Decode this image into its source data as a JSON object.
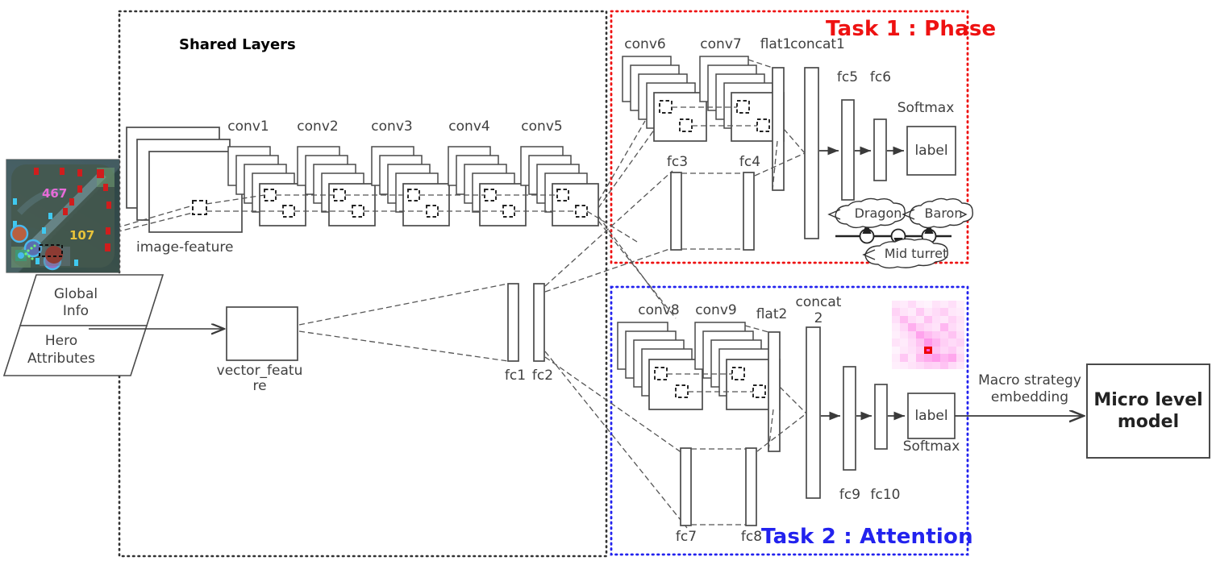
{
  "diagram": {
    "title_shared": "Shared Layers",
    "task1_label": "Task 1 : Phase",
    "task2_label": "Task 2 : Attention",
    "task1_color": "#ee1111",
    "task2_color": "#2222ee",
    "shared_border_color": "#333333"
  },
  "inputs": {
    "minimap_name": "game-minimap",
    "minimap_numbers": [
      "467",
      "107"
    ],
    "global_info": "Global\nInfo",
    "global_info_line1": "Global",
    "global_info_line2": "Info",
    "hero_attr_line1": "Hero",
    "hero_attr_line2": "Attributes",
    "image_feature": "image-feature",
    "vector_feature_line1": "vector_featu",
    "vector_feature_line2": "re"
  },
  "shared": {
    "conv_labels": [
      "conv1",
      "conv2",
      "conv3",
      "conv4",
      "conv5"
    ],
    "fc_labels": [
      "fc1",
      "fc2"
    ]
  },
  "task1": {
    "conv_labels": [
      "conv6",
      "conv7"
    ],
    "flat_label": "flat1",
    "concat_label": "concat1",
    "fc_upper": [
      "fc3",
      "fc4"
    ],
    "fc_head": [
      "fc5",
      "fc6"
    ],
    "softmax_label": "Softmax",
    "label_box": "label",
    "timeline": {
      "bubbles": [
        "Dragon",
        "Baron",
        "Mid turret"
      ],
      "node_count": 3
    }
  },
  "task2": {
    "conv_labels": [
      "conv8",
      "conv9"
    ],
    "flat_label": "flat2",
    "concat_label_line1": "concat",
    "concat_label_line2": "2",
    "fc_lower": [
      "fc7",
      "fc8"
    ],
    "fc_head": [
      "fc9",
      "fc10"
    ],
    "softmax_label": "Softmax",
    "label_box": "label",
    "attention_highlight_color": "#ee0000"
  },
  "output": {
    "edge_label_line1": "Macro strategy",
    "edge_label_line2": "embedding",
    "micro_line1": "Micro level",
    "micro_line2": "model"
  },
  "chart_data": {
    "type": "diagram",
    "title": "Multi-task macro strategy network (Shared Layers + Task 1 Phase + Task 2 Attention)",
    "nodes": [
      "image-feature",
      "conv1",
      "conv2",
      "conv3",
      "conv4",
      "conv5",
      "vector_feature",
      "fc1",
      "fc2",
      "conv6",
      "conv7",
      "flat1",
      "fc3",
      "fc4",
      "concat1",
      "fc5",
      "fc6",
      "label(Softmax)",
      "conv8",
      "conv9",
      "flat2",
      "fc7",
      "fc8",
      "concat2",
      "fc9",
      "fc10",
      "label(Softmax)",
      "Micro level model"
    ],
    "attention_grid": {
      "rows": 9,
      "cols": 9,
      "highlight_row": 6,
      "highlight_col": 4,
      "values": [
        [
          0.12,
          0.1,
          0.18,
          0.08,
          0.06,
          0.14,
          0.1,
          0.16,
          0.07
        ],
        [
          0.22,
          0.14,
          0.1,
          0.26,
          0.12,
          0.18,
          0.24,
          0.12,
          0.1
        ],
        [
          0.16,
          0.34,
          0.18,
          0.12,
          0.3,
          0.16,
          0.12,
          0.22,
          0.14
        ],
        [
          0.1,
          0.2,
          0.4,
          0.24,
          0.18,
          0.14,
          0.36,
          0.18,
          0.12
        ],
        [
          0.08,
          0.14,
          0.22,
          0.46,
          0.34,
          0.26,
          0.2,
          0.3,
          0.16
        ],
        [
          0.14,
          0.1,
          0.18,
          0.3,
          0.52,
          0.38,
          0.24,
          0.18,
          0.22
        ],
        [
          0.06,
          0.12,
          0.16,
          0.24,
          0.88,
          0.3,
          0.2,
          0.26,
          0.14
        ],
        [
          0.1,
          0.28,
          0.12,
          0.34,
          0.42,
          0.5,
          0.36,
          0.44,
          0.2
        ],
        [
          0.08,
          0.1,
          0.14,
          0.18,
          0.24,
          0.22,
          0.3,
          0.18,
          0.12
        ]
      ]
    }
  }
}
